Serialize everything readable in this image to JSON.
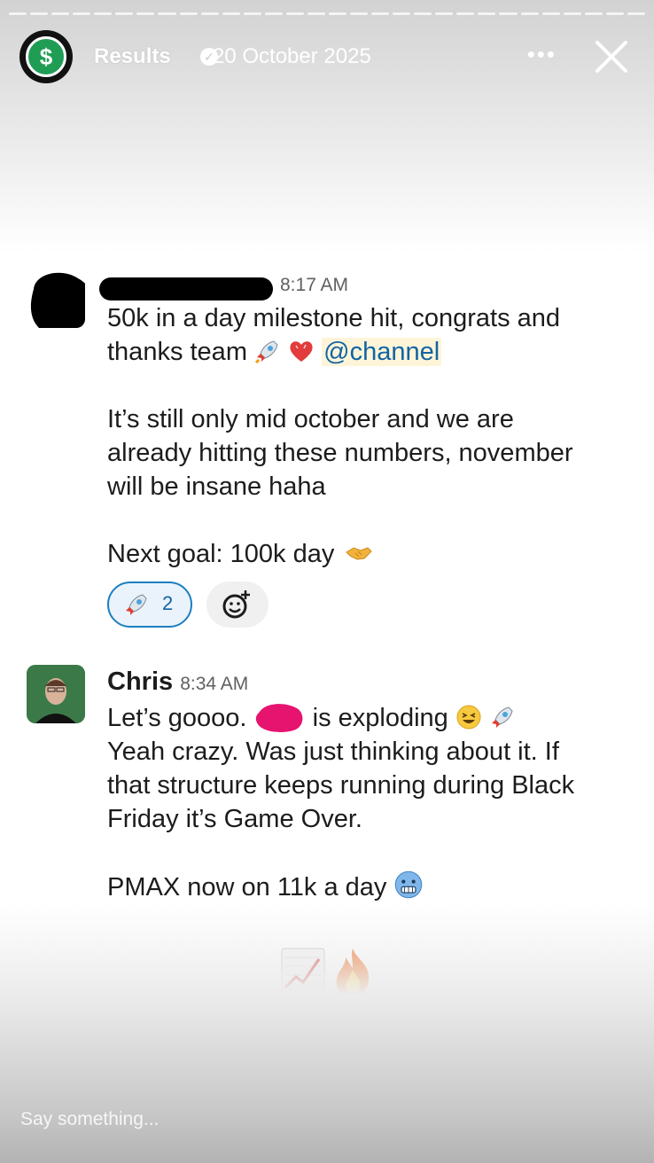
{
  "story": {
    "account_name": "Results",
    "date": "20 October 2025",
    "more_label": "•••",
    "reply_placeholder": "Say something..."
  },
  "messages": [
    {
      "time": "8:17 AM",
      "line1": "50k in a day milestone hit, congrats and",
      "line2_prefix": "thanks team",
      "mention": "@channel",
      "para2_line1": "It’s still only mid october and we are",
      "para2_line2": "already hitting these numbers, november",
      "para2_line3": "will be insane haha",
      "goal": "Next goal: 100k day",
      "reaction_count": "2"
    },
    {
      "sender": "Chris",
      "time": "8:34 AM",
      "line1_prefix": "Let’s goooo.",
      "line1_suffix": "is exploding",
      "line2": "Yeah crazy. Was just thinking about it. If",
      "line3": "that structure keeps running during Black",
      "line4": "Friday it’s Game Over.",
      "line5": "PMAX now on 11k a day"
    }
  ],
  "colors": {
    "mention_text": "#1264a3",
    "mention_bg": "#fef5d9",
    "reaction_border": "#1d7fbf",
    "avatar_green": "#1f9d55"
  },
  "icons": [
    "dollar-icon",
    "verified-icon",
    "more-icon",
    "close-icon",
    "rocket-icon",
    "heart-icon",
    "handshake-icon",
    "add-emoji-icon",
    "grin-icon",
    "cold-face-icon",
    "chart-up-icon",
    "fire-icon"
  ]
}
